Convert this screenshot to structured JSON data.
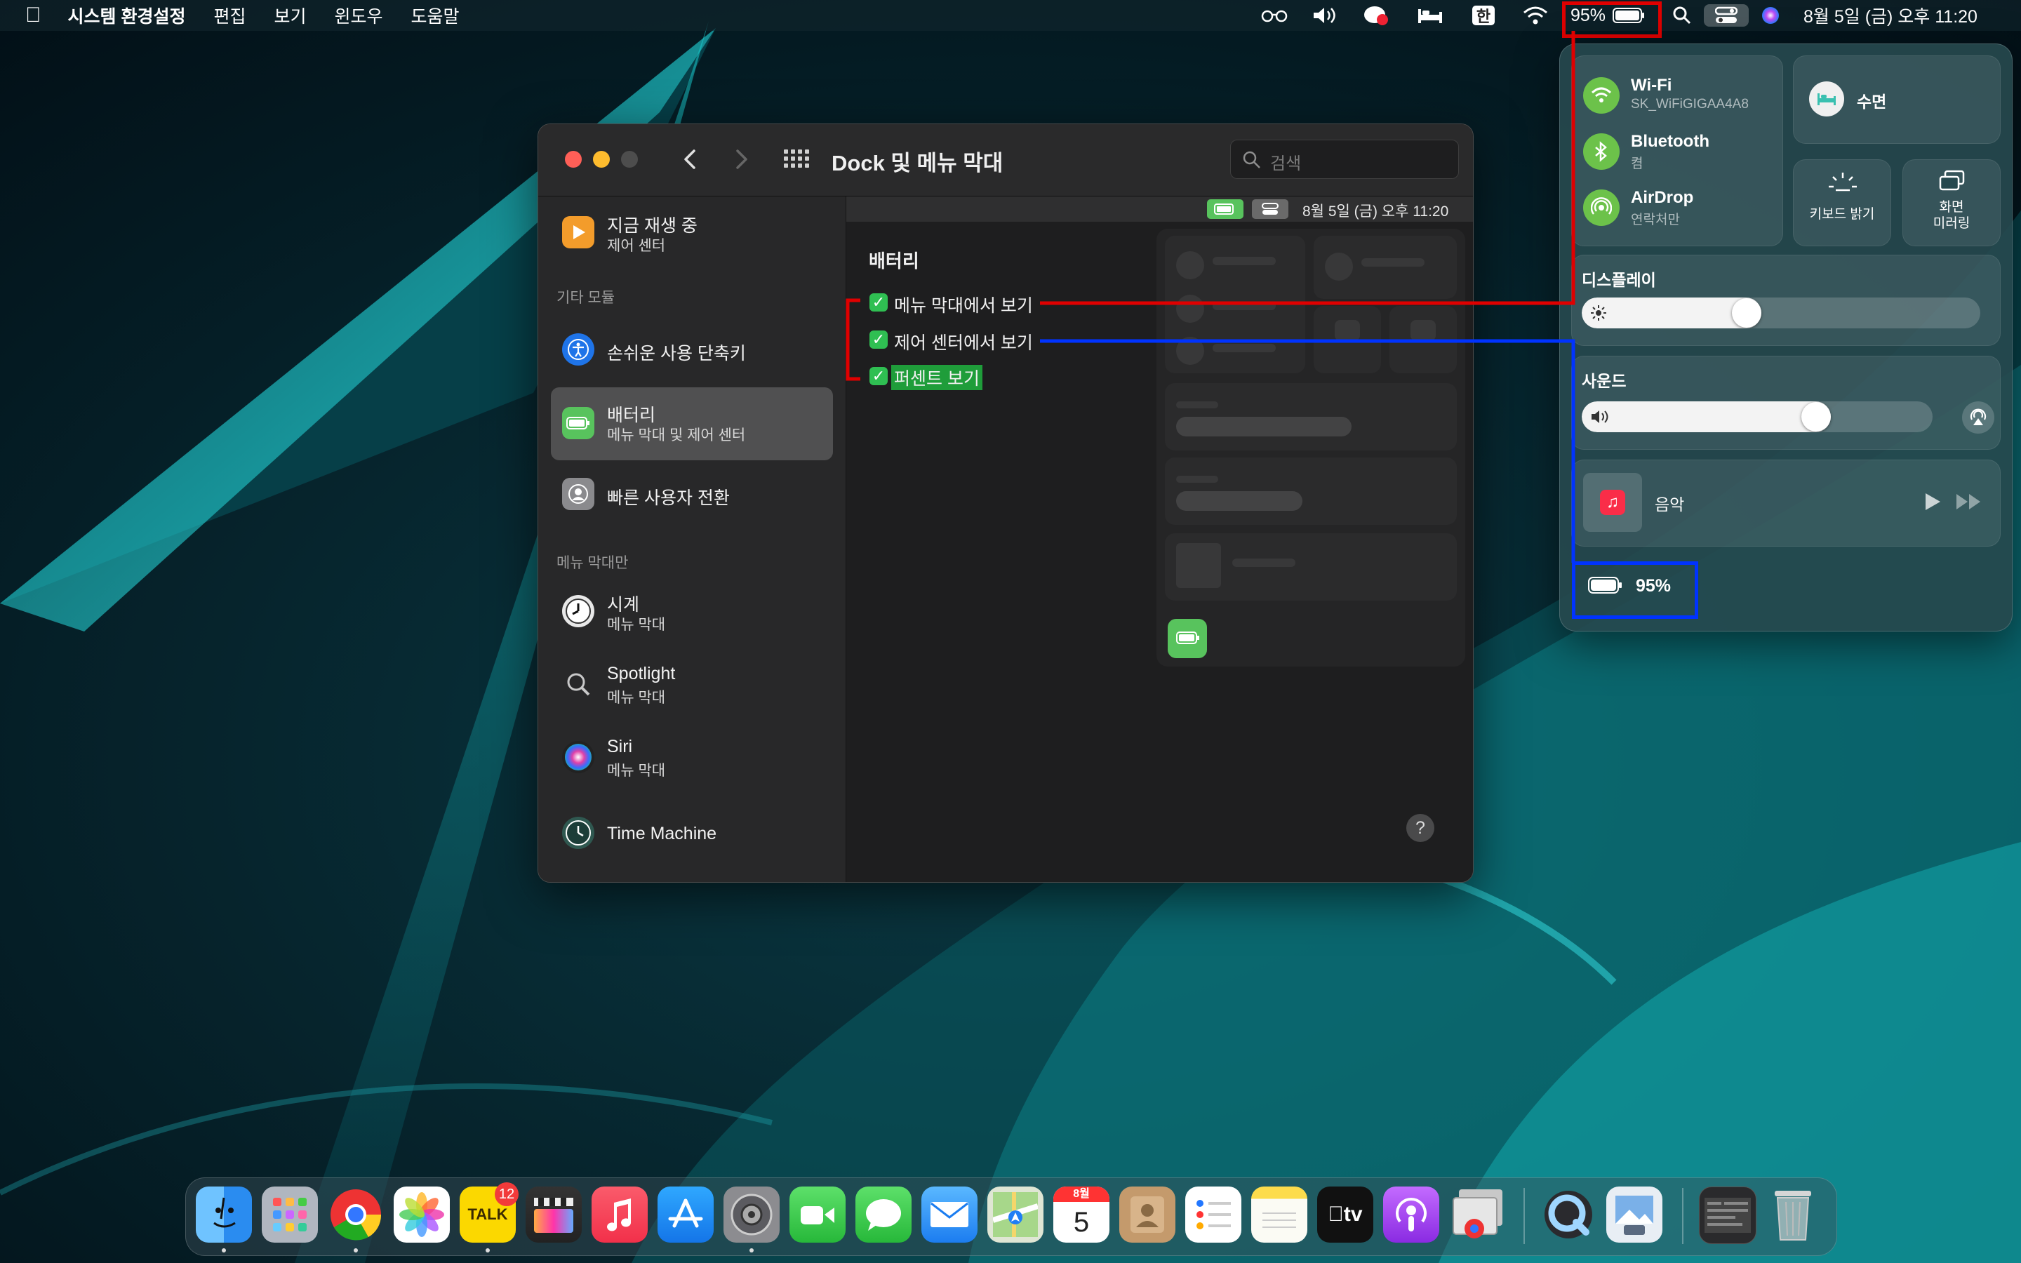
{
  "menubar": {
    "app_name": "시스템 환경설정",
    "menus": [
      "편집",
      "보기",
      "윈도우",
      "도움말"
    ],
    "battery_percent": "95%",
    "input_method": "한",
    "clock": "8월 5일 (금) 오후 11:20"
  },
  "window": {
    "title": "Dock 및 메뉴 막대",
    "search_placeholder": "검색",
    "sidebar": {
      "now_playing": {
        "title": "지금 재생 중",
        "subtitle": "제어 센터"
      },
      "section_other": "기타 모듈",
      "accessibility": {
        "title": "손쉬운 사용 단축키"
      },
      "battery": {
        "title": "배터리",
        "subtitle": "메뉴 막대 및 제어 센터"
      },
      "fast_user": {
        "title": "빠른 사용자 전환"
      },
      "section_menubar_only": "메뉴 막대만",
      "clock": {
        "title": "시계",
        "subtitle": "메뉴 막대"
      },
      "spotlight": {
        "title": "Spotlight",
        "subtitle": "메뉴 막대"
      },
      "siri": {
        "title": "Siri",
        "subtitle": "메뉴 막대"
      },
      "time_machine": {
        "title": "Time Machine"
      }
    },
    "content": {
      "preview_clock": "8월 5일 (금) 오후 11:20",
      "section_title": "배터리",
      "checkboxes": [
        {
          "label": "메뉴 막대에서 보기",
          "checked": true
        },
        {
          "label": "제어 센터에서 보기",
          "checked": true
        },
        {
          "label": "퍼센트 보기",
          "checked": true
        }
      ],
      "help": "?"
    }
  },
  "control_center": {
    "wifi": {
      "title": "Wi-Fi",
      "subtitle": "SK_WiFiGIGAA4A8"
    },
    "bluetooth": {
      "title": "Bluetooth",
      "subtitle": "켬"
    },
    "airdrop": {
      "title": "AirDrop",
      "subtitle": "연락처만"
    },
    "sleep": "수면",
    "keyboard_brightness": "키보드 밝기",
    "screen_mirroring": "화면\n미러링",
    "display_label": "디스플레이",
    "display_level": 0.45,
    "sound_label": "사운드",
    "sound_level": 0.71,
    "music_label": "음악",
    "battery_percent": "95%"
  },
  "dock": {
    "kakaotalk_label": "TALK",
    "kakaotalk_badge": "12",
    "calendar_month": "8월",
    "calendar_day": "5",
    "appletv_label": "tv"
  },
  "colors": {
    "accent_green": "#2fbf52",
    "cc_green": "#6cc24a",
    "annotation_red": "#e00000",
    "annotation_blue": "#0033ff"
  }
}
